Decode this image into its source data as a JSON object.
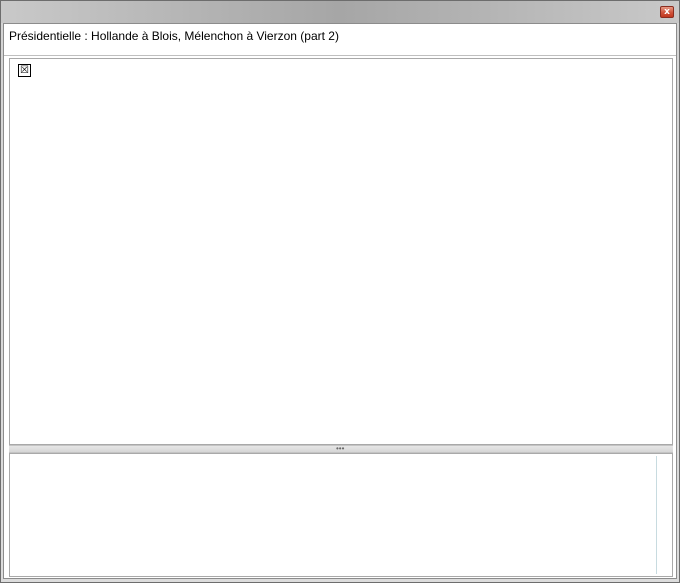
{
  "window": {
    "close_glyph": "x",
    "close_icon": "close-icon"
  },
  "header": {
    "title": "Présidentielle : Hollande à Blois, Mélenchon à Vierzon (part 2)"
  },
  "content": {
    "image_icon": "broken-image-icon",
    "image_glyph": "☒"
  },
  "splitter": {
    "grip_icon": "grip-dots-icon",
    "grip_glyph": "•••"
  }
}
